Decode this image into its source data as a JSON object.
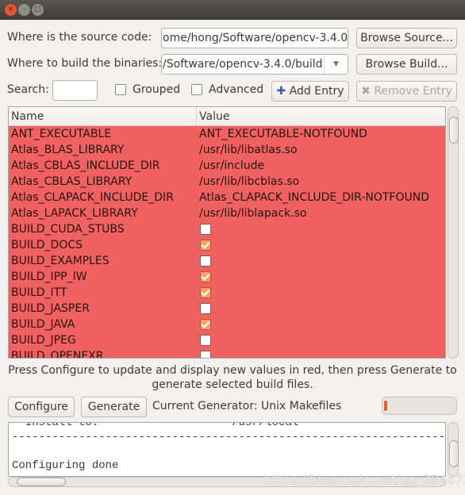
{
  "window": {
    "close": "×",
    "minimize": "–",
    "maximize": "□"
  },
  "source": {
    "label": "Where is the source code:",
    "value": "ome/hong/Software/opencv-3.4.0",
    "browse": "Browse Source..."
  },
  "build": {
    "label": "Where to build the binaries:",
    "value": "/Software/opencv-3.4.0/build",
    "browse": "Browse Build..."
  },
  "search": {
    "label": "Search:",
    "value": ""
  },
  "grouped": {
    "label": "Grouped",
    "checked": false
  },
  "advanced": {
    "label": "Advanced",
    "checked": false
  },
  "add_entry": "Add Entry",
  "remove_entry": "Remove Entry",
  "table": {
    "columns": [
      "Name",
      "Value"
    ],
    "row_color": "#f06262",
    "rows": [
      {
        "name": "ANT_EXECUTABLE",
        "value": "ANT_EXECUTABLE-NOTFOUND"
      },
      {
        "name": "Atlas_BLAS_LIBRARY",
        "value": "/usr/lib/libatlas.so"
      },
      {
        "name": "Atlas_CBLAS_INCLUDE_DIR",
        "value": "/usr/include"
      },
      {
        "name": "Atlas_CBLAS_LIBRARY",
        "value": "/usr/lib/libcblas.so"
      },
      {
        "name": "Atlas_CLAPACK_INCLUDE_DIR",
        "value": "Atlas_CLAPACK_INCLUDE_DIR-NOTFOUND"
      },
      {
        "name": "Atlas_LAPACK_LIBRARY",
        "value": "/usr/lib/liblapack.so"
      },
      {
        "name": "BUILD_CUDA_STUBS",
        "checked": false
      },
      {
        "name": "BUILD_DOCS",
        "checked": true
      },
      {
        "name": "BUILD_EXAMPLES",
        "checked": false
      },
      {
        "name": "BUILD_IPP_IW",
        "checked": true
      },
      {
        "name": "BUILD_ITT",
        "checked": true
      },
      {
        "name": "BUILD_JASPER",
        "checked": false
      },
      {
        "name": "BUILD_JAVA",
        "checked": true
      },
      {
        "name": "BUILD_JPEG",
        "checked": false
      },
      {
        "name": "BUILD_OPENEXR",
        "checked": false
      }
    ]
  },
  "message": [
    "Press Configure to update and display new values in red, then press Generate to",
    "generate selected build files."
  ],
  "configure": "Configure",
  "generate": "Generate",
  "generator": "Current Generator: Unix Makefiles",
  "progress": 0.02,
  "output": [
    "  Install to:                    /usr/local",
    "-----------------------------------------------------------------",
    "",
    "Configuring done"
  ],
  "watermark": "https://blog.csdn.net/qq_28467357"
}
